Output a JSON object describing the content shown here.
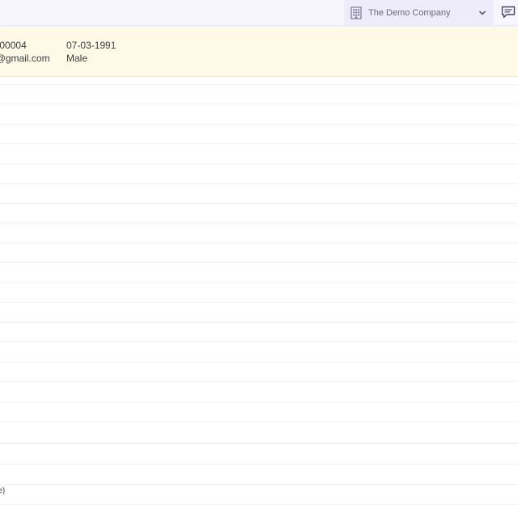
{
  "header": {
    "company_name": "The Demo Company",
    "company_icon": "building-icon",
    "dropdown_icon": "chevron-down-icon",
    "chat_icon": "chat-icon"
  },
  "selected_record": {
    "phone_tail": "4",
    "email_tail": "r@gmail.com",
    "dob": "07-03-1991",
    "gender": "Male"
  },
  "footer_stub": "e)",
  "colors": {
    "topbar_bg": "#f7f5fd",
    "company_bg": "#eeebfb",
    "selected_row_bg": "#fffae8"
  }
}
